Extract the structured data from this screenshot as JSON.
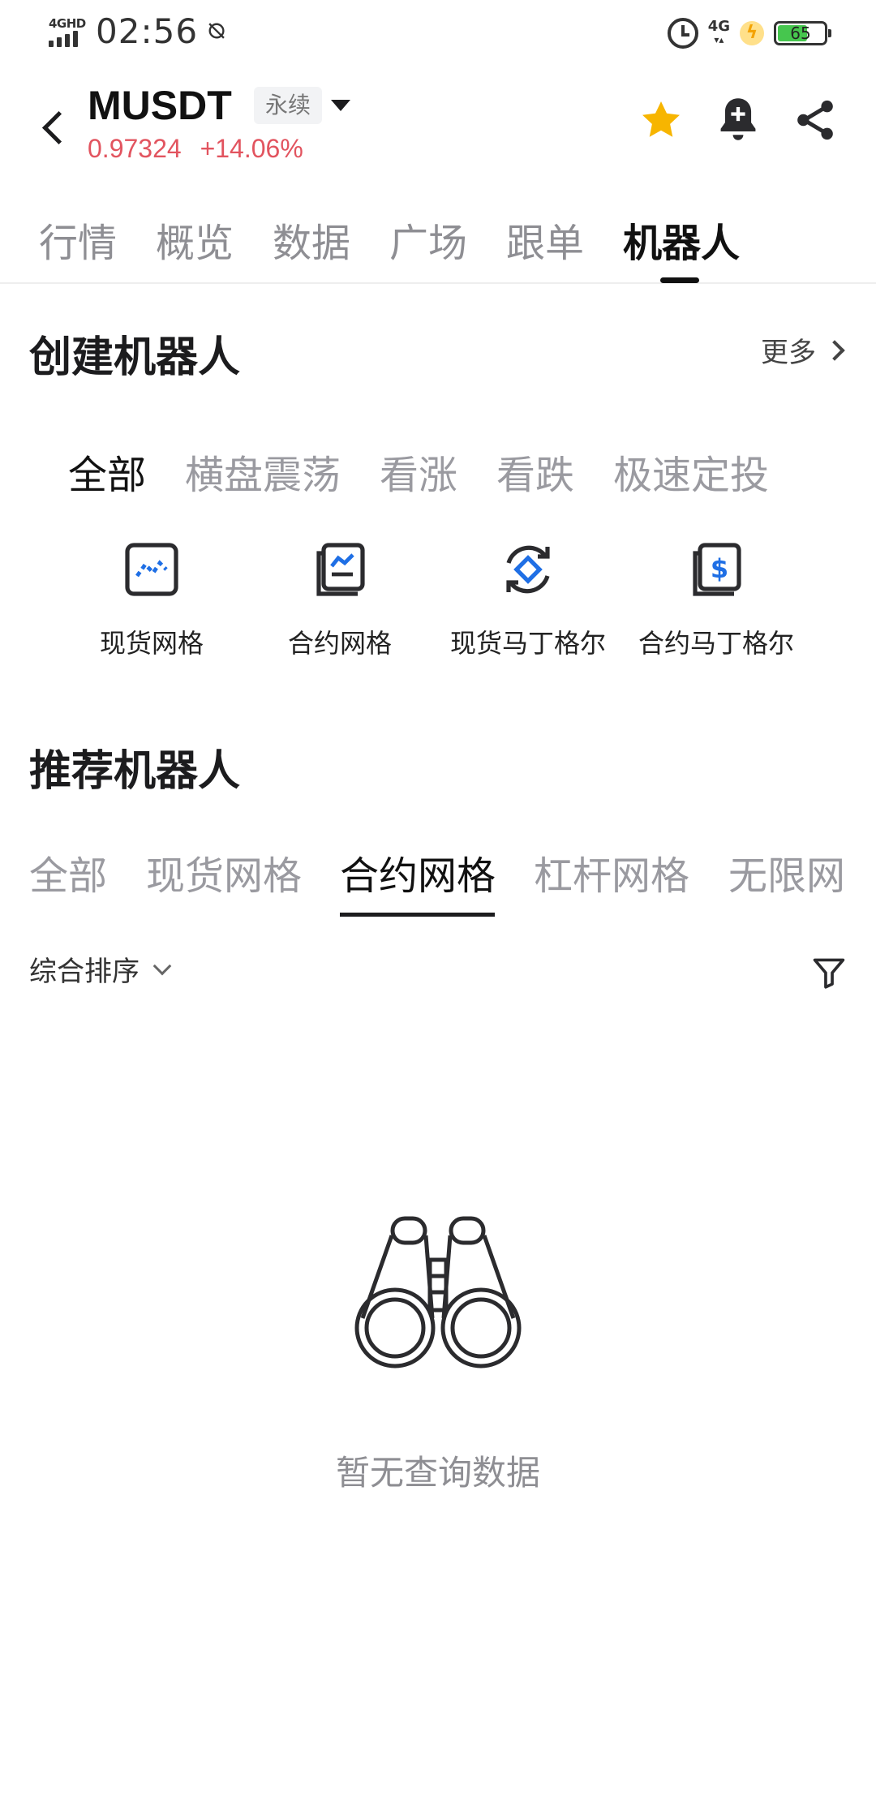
{
  "status_bar": {
    "network_label": "4GHD",
    "time": "02:56",
    "network_type": "4G",
    "battery_level": "65"
  },
  "header": {
    "symbol": "MUSDT",
    "contract_tag": "永续",
    "price": "0.97324",
    "change": "+14.06%",
    "price_color": "#e2545f",
    "star_color": "#f7b500"
  },
  "main_tabs": [
    {
      "label": "行情",
      "active": false
    },
    {
      "label": "概览",
      "active": false
    },
    {
      "label": "数据",
      "active": false
    },
    {
      "label": "广场",
      "active": false
    },
    {
      "label": "跟单",
      "active": false
    },
    {
      "label": "机器人",
      "active": true
    }
  ],
  "create_section": {
    "title": "创建机器人",
    "more_label": "更多"
  },
  "categories": [
    {
      "label": "全部",
      "active": true
    },
    {
      "label": "横盘震荡",
      "active": false
    },
    {
      "label": "看涨",
      "active": false
    },
    {
      "label": "看跌",
      "active": false
    },
    {
      "label": "极速定投",
      "active": false
    }
  ],
  "bot_types": [
    {
      "label": "现货网格",
      "icon": "spot-grid-icon"
    },
    {
      "label": "合约网格",
      "icon": "futures-grid-icon"
    },
    {
      "label": "现货马丁格尔",
      "icon": "spot-martingale-icon"
    },
    {
      "label": "合约马丁格尔",
      "icon": "futures-martingale-icon"
    }
  ],
  "recommend_section": {
    "title": "推荐机器人"
  },
  "recommend_tabs": [
    {
      "label": "全部",
      "active": false
    },
    {
      "label": "现货网格",
      "active": false
    },
    {
      "label": "合约网格",
      "active": true
    },
    {
      "label": "杠杆网格",
      "active": false
    },
    {
      "label": "无限网",
      "active": false
    }
  ],
  "sort": {
    "label": "综合排序"
  },
  "empty_state": {
    "text": "暂无查询数据",
    "icon": "binoculars-icon"
  },
  "accent_colors": {
    "icon_blue": "#1f6fe5"
  }
}
